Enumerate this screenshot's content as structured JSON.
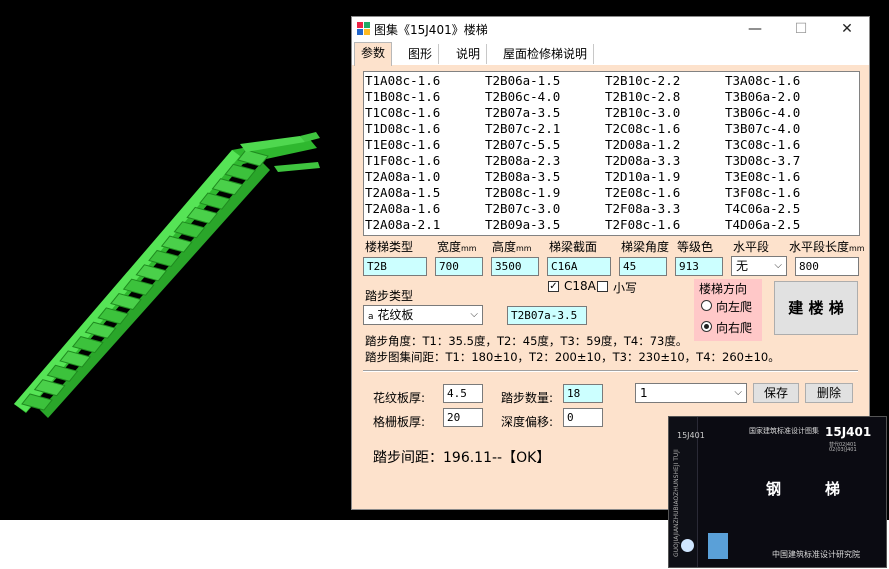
{
  "window": {
    "title": "图集《15J401》楼梯",
    "minimize": "—",
    "maximize": "☐",
    "close": "✕"
  },
  "tabs": [
    "参数",
    "图形",
    "说明",
    "屋面检修梯说明"
  ],
  "list_columns": [
    [
      "T1A08c-1.6",
      "T1B08c-1.6",
      "T1C08c-1.6",
      "T1D08c-1.6",
      "T1E08c-1.6",
      "T1F08c-1.6",
      "T2A08a-1.0",
      "T2A08a-1.5",
      "T2A08a-1.6",
      "T2A08a-2.1"
    ],
    [
      "T2B06a-1.5",
      "T2B06c-4.0",
      "T2B07a-3.5",
      "T2B07c-2.1",
      "T2B07c-5.5",
      "T2B08a-2.3",
      "T2B08a-3.5",
      "T2B08c-1.9",
      "T2B07c-3.0",
      "T2B09a-3.5"
    ],
    [
      "T2B10c-2.2",
      "T2B10c-2.8",
      "T2B10c-3.0",
      "T2C08c-1.6",
      "T2D08a-1.2",
      "T2D08a-3.3",
      "T2D10a-1.9",
      "T2E08c-1.6",
      "T2F08a-3.3",
      "T2F08c-1.6"
    ],
    [
      "T3A08c-1.6",
      "T3B06a-2.0",
      "T3B06c-4.0",
      "T3B07c-4.0",
      "T3C08c-1.6",
      "T3D08c-3.7",
      "T3E08c-1.6",
      "T3F08c-1.6",
      "T4C06a-2.5",
      "T4D06a-2.5"
    ]
  ],
  "params": {
    "stair_type_label": "楼梯类型",
    "stair_type": "T2B",
    "width_label": "宽度",
    "width_unit": "mm",
    "width": "700",
    "height_label": "高度",
    "height_unit": "mm",
    "height": "3500",
    "beam_label": "梯梁截面",
    "beam": "C16A",
    "angle_label": "梯梁角度",
    "angle": "45",
    "grade_label": "等级色",
    "grade": "913",
    "horizontal_label": "水平段",
    "horizontal": "无",
    "horizontal_len_label": "水平段长度",
    "horizontal_len_unit": "mm",
    "horizontal_len": "800"
  },
  "tread": {
    "type_label": "踏步类型",
    "type_prefix": "a",
    "type_value": "花纹板",
    "code": "T2B07a-3.5"
  },
  "checkboxes": {
    "c18a_label": "C18A",
    "c18a_checked": "✓",
    "lower_label": "小写"
  },
  "direction": {
    "title": "楼梯方向",
    "left": "向左爬",
    "right": "向右爬"
  },
  "build_button": "建 楼 梯",
  "info": {
    "angles": "踏步角度：T1：35.5度，T2：45度，T3：59度，T4：73度。",
    "spacing": "踏步图集间距：T1：180±10，T2：200±10，T3：230±10，T4：260±10。"
  },
  "bottom": {
    "plate_thick_label": "花纹板厚:",
    "plate_thick": "4.5",
    "count_label": "踏步数量:",
    "count": "18",
    "grate_thick_label": "格栅板厚:",
    "grate_thick": "20",
    "depth_label": "深度偏移:",
    "depth": "0",
    "combo": "1",
    "save": "保存",
    "delete": "删除",
    "result": "踏步间距：196.11--【OK】"
  },
  "cover": {
    "atlas_name": "国家建筑标准设计图集",
    "code": "15J401",
    "small1": "替代02J401",
    "small2": "02(03)J401",
    "title_a": "钢",
    "title_b": "梯",
    "vertical_code": "15J401",
    "vertical_text": "GUOJIAJIANZHUBIAOZHUNSHEJI TUJI",
    "publisher": "中国建筑标准设计研究院"
  },
  "colors": {
    "window_bg": "#fde2cc",
    "cyan_input": "#ccffff",
    "direction_bg": "#ffc8c8",
    "stair_green": "#3fd23f"
  }
}
